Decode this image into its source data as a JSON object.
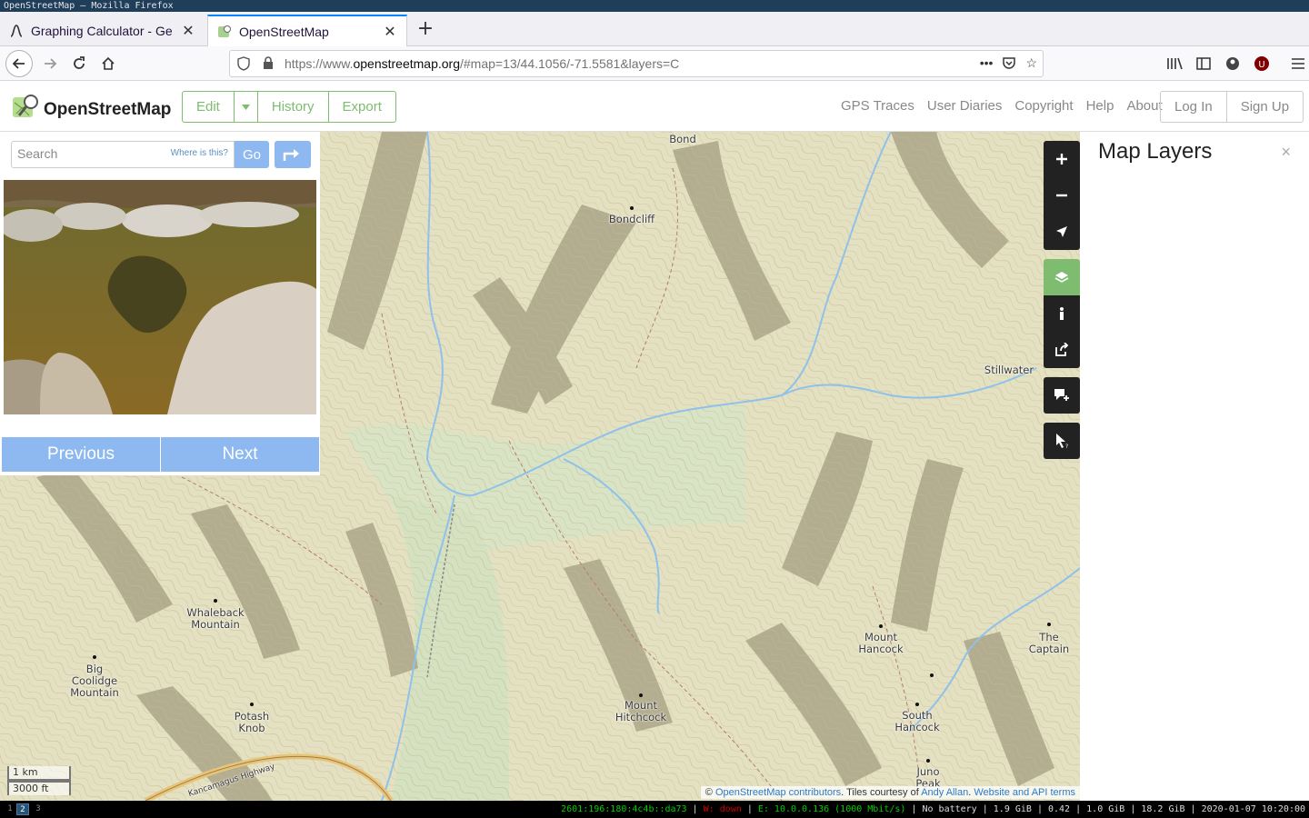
{
  "os": {
    "window_title": "OpenStreetMap — Mozilla Firefox"
  },
  "browser": {
    "tabs": [
      {
        "label": "Graphing Calculator - Ge"
      },
      {
        "label": "OpenStreetMap"
      }
    ],
    "url_prefix": "https://www.",
    "url_domain": "openstreetmap.org",
    "url_rest": "/#map=13/44.1056/-71.5581&layers=C"
  },
  "header": {
    "site_name": "OpenStreetMap",
    "edit": "Edit",
    "history": "History",
    "export": "Export",
    "links": [
      "GPS Traces",
      "User Diaries",
      "Copyright",
      "Help",
      "About"
    ],
    "login": "Log In",
    "signup": "Sign Up"
  },
  "sidebar": {
    "search_placeholder": "Search",
    "where_is_this": "Where is this?",
    "go": "Go",
    "previous": "Previous",
    "next": "Next"
  },
  "map": {
    "places": [
      {
        "name": "Bond"
      },
      {
        "name": "Bondcliff"
      },
      {
        "name": "Stillwater"
      },
      {
        "name": "Whaleback\nMountain"
      },
      {
        "name": "Big\nCoolidge\nMountain"
      },
      {
        "name": "Potash\nKnob"
      },
      {
        "name": "Mount\nHitchcock"
      },
      {
        "name": "Mount\nHancock"
      },
      {
        "name": "The\nCaptain"
      },
      {
        "name": "South\nHancock"
      },
      {
        "name": "Juno\nPeak"
      }
    ],
    "road_label": "Kancamagus Highway",
    "scale_km": "1 km",
    "scale_ft": "3000 ft",
    "attribution_prefix": "© ",
    "attribution_link1": "OpenStreetMap contributors",
    "attribution_mid": ". Tiles courtesy of ",
    "attribution_link2": "Andy Allan",
    "attribution_sep": ". ",
    "attribution_link3": "Website and API terms"
  },
  "layers": {
    "title": "Map Layers",
    "close": "×"
  },
  "statusbar": {
    "workspaces": [
      "1",
      "2",
      "3"
    ],
    "ipv6": "2601:196:180:4c4b::da73",
    "wifi": "W: down",
    "eth": "E: 10.0.0.136 (1000 Mbit/s)",
    "battery": "No battery",
    "mem": "1.9 GiB",
    "load": "0.42",
    "mem2": "1.0 GiB",
    "disk": "18.2 GiB",
    "datetime": "2020-01-07 10:20:00"
  }
}
